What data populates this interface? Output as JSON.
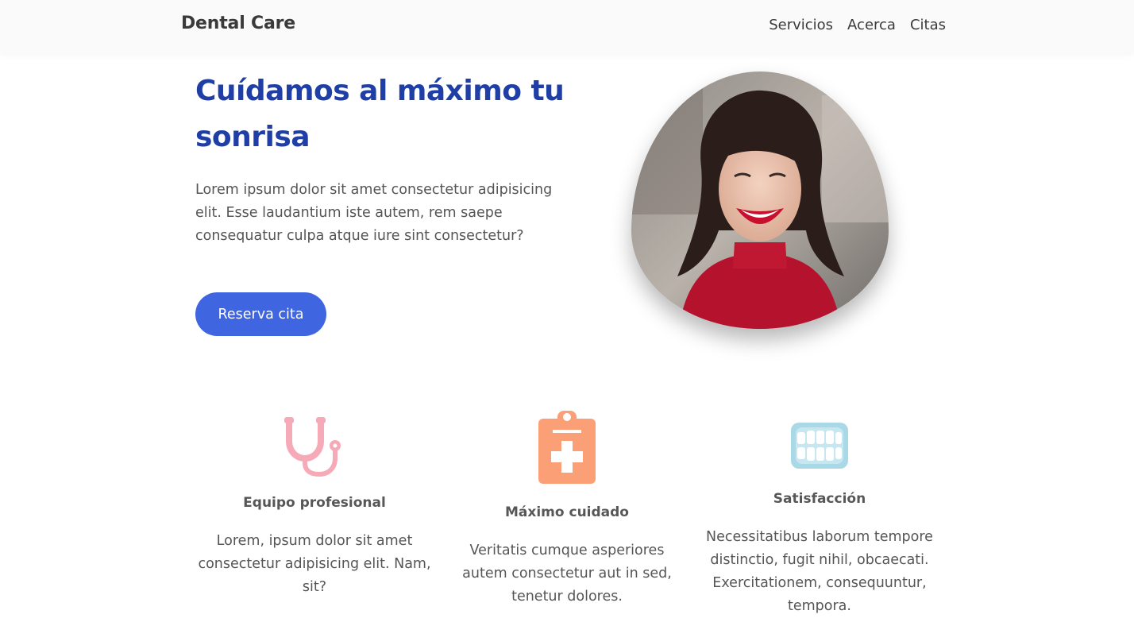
{
  "navbar": {
    "brand": "Dental Care",
    "links": [
      "Servicios",
      "Acerca",
      "Citas"
    ]
  },
  "hero": {
    "title": "Cuídamos al máximo tu sonrisa",
    "text": "Lorem ipsum dolor sit amet consectetur adipisicing elit. Esse laudantium iste autem, rem saepe consequatur culpa atque iure sint consectetur?",
    "cta_label": "Reserva cita",
    "photo_alt": "smiling-woman-photo"
  },
  "features": [
    {
      "icon": "stethoscope-icon",
      "icon_color": "#f6aab8",
      "title": "Equipo profesional",
      "text": "Lorem, ipsum dolor sit amet consectetur adipisicing elit. Nam, sit?"
    },
    {
      "icon": "medical-clipboard-icon",
      "icon_color": "#fb9f77",
      "title": "Máximo cuidado",
      "text": "Veritatis cumque asperiores autem consectetur aut in sed, tenetur dolores."
    },
    {
      "icon": "teeth-icon",
      "icon_color": "#a9d9e6",
      "title": "Satisfacción",
      "text": "Necessitatibus laborum tempore distinctio, fugit nihil, obcaecati. Exercitationem, consequuntur, tempora."
    }
  ],
  "colors": {
    "accent": "#3f66e0",
    "title": "#1f3fa6",
    "navbar_bg": "#fbfafb"
  }
}
